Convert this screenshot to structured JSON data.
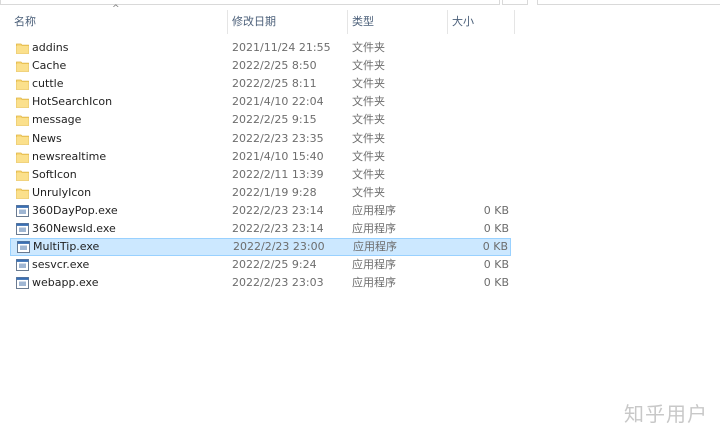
{
  "columns": {
    "name": "名称",
    "modified": "修改日期",
    "type": "类型",
    "size": "大小",
    "sort_indicator": "^"
  },
  "files": [
    {
      "name": "addins",
      "modified": "2021/11/24 21:55",
      "type": "文件夹",
      "size": "",
      "icon": "folder-icon"
    },
    {
      "name": "Cache",
      "modified": "2022/2/25 8:50",
      "type": "文件夹",
      "size": "",
      "icon": "folder-icon"
    },
    {
      "name": "cuttle",
      "modified": "2022/2/25 8:11",
      "type": "文件夹",
      "size": "",
      "icon": "folder-icon"
    },
    {
      "name": "HotSearchIcon",
      "modified": "2021/4/10 22:04",
      "type": "文件夹",
      "size": "",
      "icon": "folder-icon"
    },
    {
      "name": "message",
      "modified": "2022/2/25 9:15",
      "type": "文件夹",
      "size": "",
      "icon": "folder-icon"
    },
    {
      "name": "News",
      "modified": "2022/2/23 23:35",
      "type": "文件夹",
      "size": "",
      "icon": "folder-icon"
    },
    {
      "name": "newsrealtime",
      "modified": "2021/4/10 15:40",
      "type": "文件夹",
      "size": "",
      "icon": "folder-icon"
    },
    {
      "name": "SoftIcon",
      "modified": "2022/2/11 13:39",
      "type": "文件夹",
      "size": "",
      "icon": "folder-icon"
    },
    {
      "name": "UnrulyIcon",
      "modified": "2022/1/19 9:28",
      "type": "文件夹",
      "size": "",
      "icon": "folder-icon"
    },
    {
      "name": "360DayPop.exe",
      "modified": "2022/2/23 23:14",
      "type": "应用程序",
      "size": "0 KB",
      "icon": "exe-icon"
    },
    {
      "name": "360Newsld.exe",
      "modified": "2022/2/23 23:14",
      "type": "应用程序",
      "size": "0 KB",
      "icon": "exe-icon"
    },
    {
      "name": "MultiTip.exe",
      "modified": "2022/2/23 23:00",
      "type": "应用程序",
      "size": "0 KB",
      "icon": "exe-icon",
      "selected": true
    },
    {
      "name": "sesvcr.exe",
      "modified": "2022/2/25 9:24",
      "type": "应用程序",
      "size": "0 KB",
      "icon": "exe-icon"
    },
    {
      "name": "webapp.exe",
      "modified": "2022/2/23 23:03",
      "type": "应用程序",
      "size": "0 KB",
      "icon": "exe-icon"
    }
  ],
  "watermark": "知乎用户",
  "colors": {
    "selection_bg": "#cce8ff",
    "selection_border": "#99d1ff",
    "folder": "#f8d775",
    "header_text": "#4c607a"
  }
}
